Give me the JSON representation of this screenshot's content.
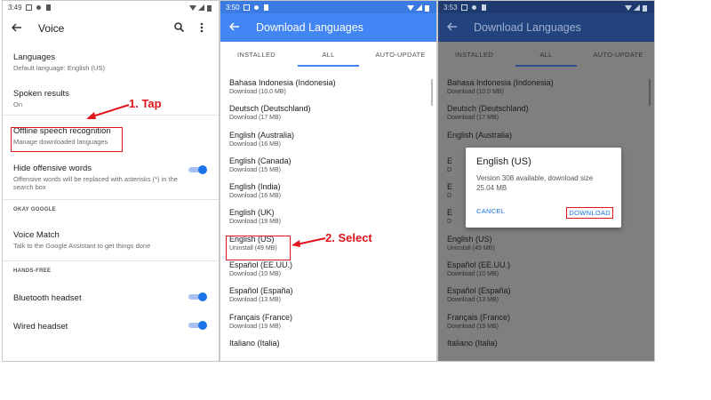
{
  "phone1": {
    "status_time": "3:49",
    "title": "Voice",
    "items": [
      {
        "title": "Languages",
        "sub": "Default language: English (US)"
      },
      {
        "title": "Spoken results",
        "sub": "On"
      },
      {
        "title": "Offline speech recognition",
        "sub": "Manage downloaded languages"
      },
      {
        "title": "Hide offensive words",
        "sub": "Offensive words will be replaced with asterisks (*) in the search box"
      }
    ],
    "section_okay_google": "OKAY GOOGLE",
    "voice_match": {
      "title": "Voice Match",
      "sub": "Talk to the Google Assistant to get things done"
    },
    "section_hands_free": "HANDS-FREE",
    "bluetooth": "Bluetooth headset",
    "wired": "Wired headset",
    "toggles": {
      "hide_offensive": true,
      "bluetooth": true,
      "wired": true
    }
  },
  "annotations": {
    "step1": "1. Tap",
    "step2": "2. Select",
    "color": "#e0141a"
  },
  "phone2": {
    "status_time": "3:50",
    "title": "Download Languages",
    "tabs": [
      "INSTALLED",
      "ALL",
      "AUTO-UPDATE"
    ],
    "active_tab": "ALL",
    "languages": [
      {
        "name": "Bahasa Indonesia (Indonesia)",
        "sub": "Download (10.0 MB)"
      },
      {
        "name": "Deutsch (Deutschland)",
        "sub": "Download (17 MB)"
      },
      {
        "name": "English (Australia)",
        "sub": "Download (16 MB)"
      },
      {
        "name": "English (Canada)",
        "sub": "Download (15 MB)"
      },
      {
        "name": "English (India)",
        "sub": "Download (16 MB)"
      },
      {
        "name": "English (UK)",
        "sub": "Download (19 MB)"
      },
      {
        "name": "English (US)",
        "sub": "Uninstall (49 MB)"
      },
      {
        "name": "Español (EE.UU.)",
        "sub": "Download (10 MB)"
      },
      {
        "name": "Español (España)",
        "sub": "Download (13 MB)"
      },
      {
        "name": "Français (France)",
        "sub": "Download (19 MB)"
      },
      {
        "name": "Italiano (Italia)",
        "sub": ""
      }
    ],
    "accent": "#4285f4"
  },
  "phone3": {
    "status_time": "3:53",
    "title": "Download Languages",
    "tabs": [
      "INSTALLED",
      "ALL",
      "AUTO-UPDATE"
    ],
    "languages": [
      {
        "name": "Bahasa Indonesia (Indonesia)",
        "sub": "Download (10.0 MB)"
      },
      {
        "name": "Deutsch (Deutschland)",
        "sub": "Download (17 MB)"
      },
      {
        "name": "English (Australia)",
        "sub": ""
      },
      {
        "name": "E",
        "sub": "D"
      },
      {
        "name": "E",
        "sub": "D"
      },
      {
        "name": "E",
        "sub": "D"
      },
      {
        "name": "English (US)",
        "sub": "Uninstall (49 MB)"
      },
      {
        "name": "Español (EE.UU.)",
        "sub": "Download (10 MB)"
      },
      {
        "name": "Español (España)",
        "sub": "Download (13 MB)"
      },
      {
        "name": "Français (France)",
        "sub": "Download (19 MB)"
      },
      {
        "name": "Italiano (Italia)",
        "sub": ""
      }
    ],
    "dialog": {
      "title": "English (US)",
      "body": "Version 308 available, download size 25.04 MB",
      "cancel": "CANCEL",
      "download": "DOWNLOAD"
    }
  }
}
